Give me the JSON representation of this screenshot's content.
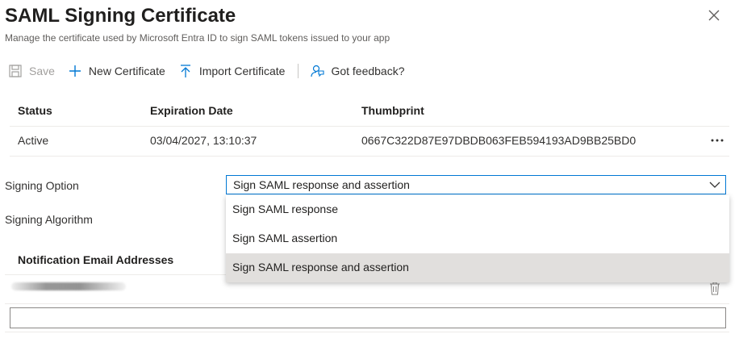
{
  "header": {
    "title": "SAML Signing Certificate",
    "subtitle": "Manage the certificate used by Microsoft Entra ID to sign SAML tokens issued to your app"
  },
  "toolbar": {
    "save_label": "Save",
    "new_cert_label": "New Certificate",
    "import_cert_label": "Import Certificate",
    "feedback_label": "Got feedback?"
  },
  "cert_table": {
    "headers": [
      "Status",
      "Expiration Date",
      "Thumbprint"
    ],
    "rows": [
      {
        "status": "Active",
        "expiration": "03/04/2027, 13:10:37",
        "thumbprint": "0667C322D87E97DBDB063FEB594193AD9BB25BD0"
      }
    ]
  },
  "signing_option": {
    "label": "Signing Option",
    "selected": "Sign SAML response and assertion",
    "options": [
      "Sign SAML response",
      "Sign SAML assertion",
      "Sign SAML response and assertion"
    ]
  },
  "signing_algorithm": {
    "label": "Signing Algorithm"
  },
  "notification": {
    "header": "Notification Email Addresses",
    "input_value": ""
  },
  "colors": {
    "accent": "#0078d4",
    "selected_option_bg": "#e1dfdd"
  }
}
